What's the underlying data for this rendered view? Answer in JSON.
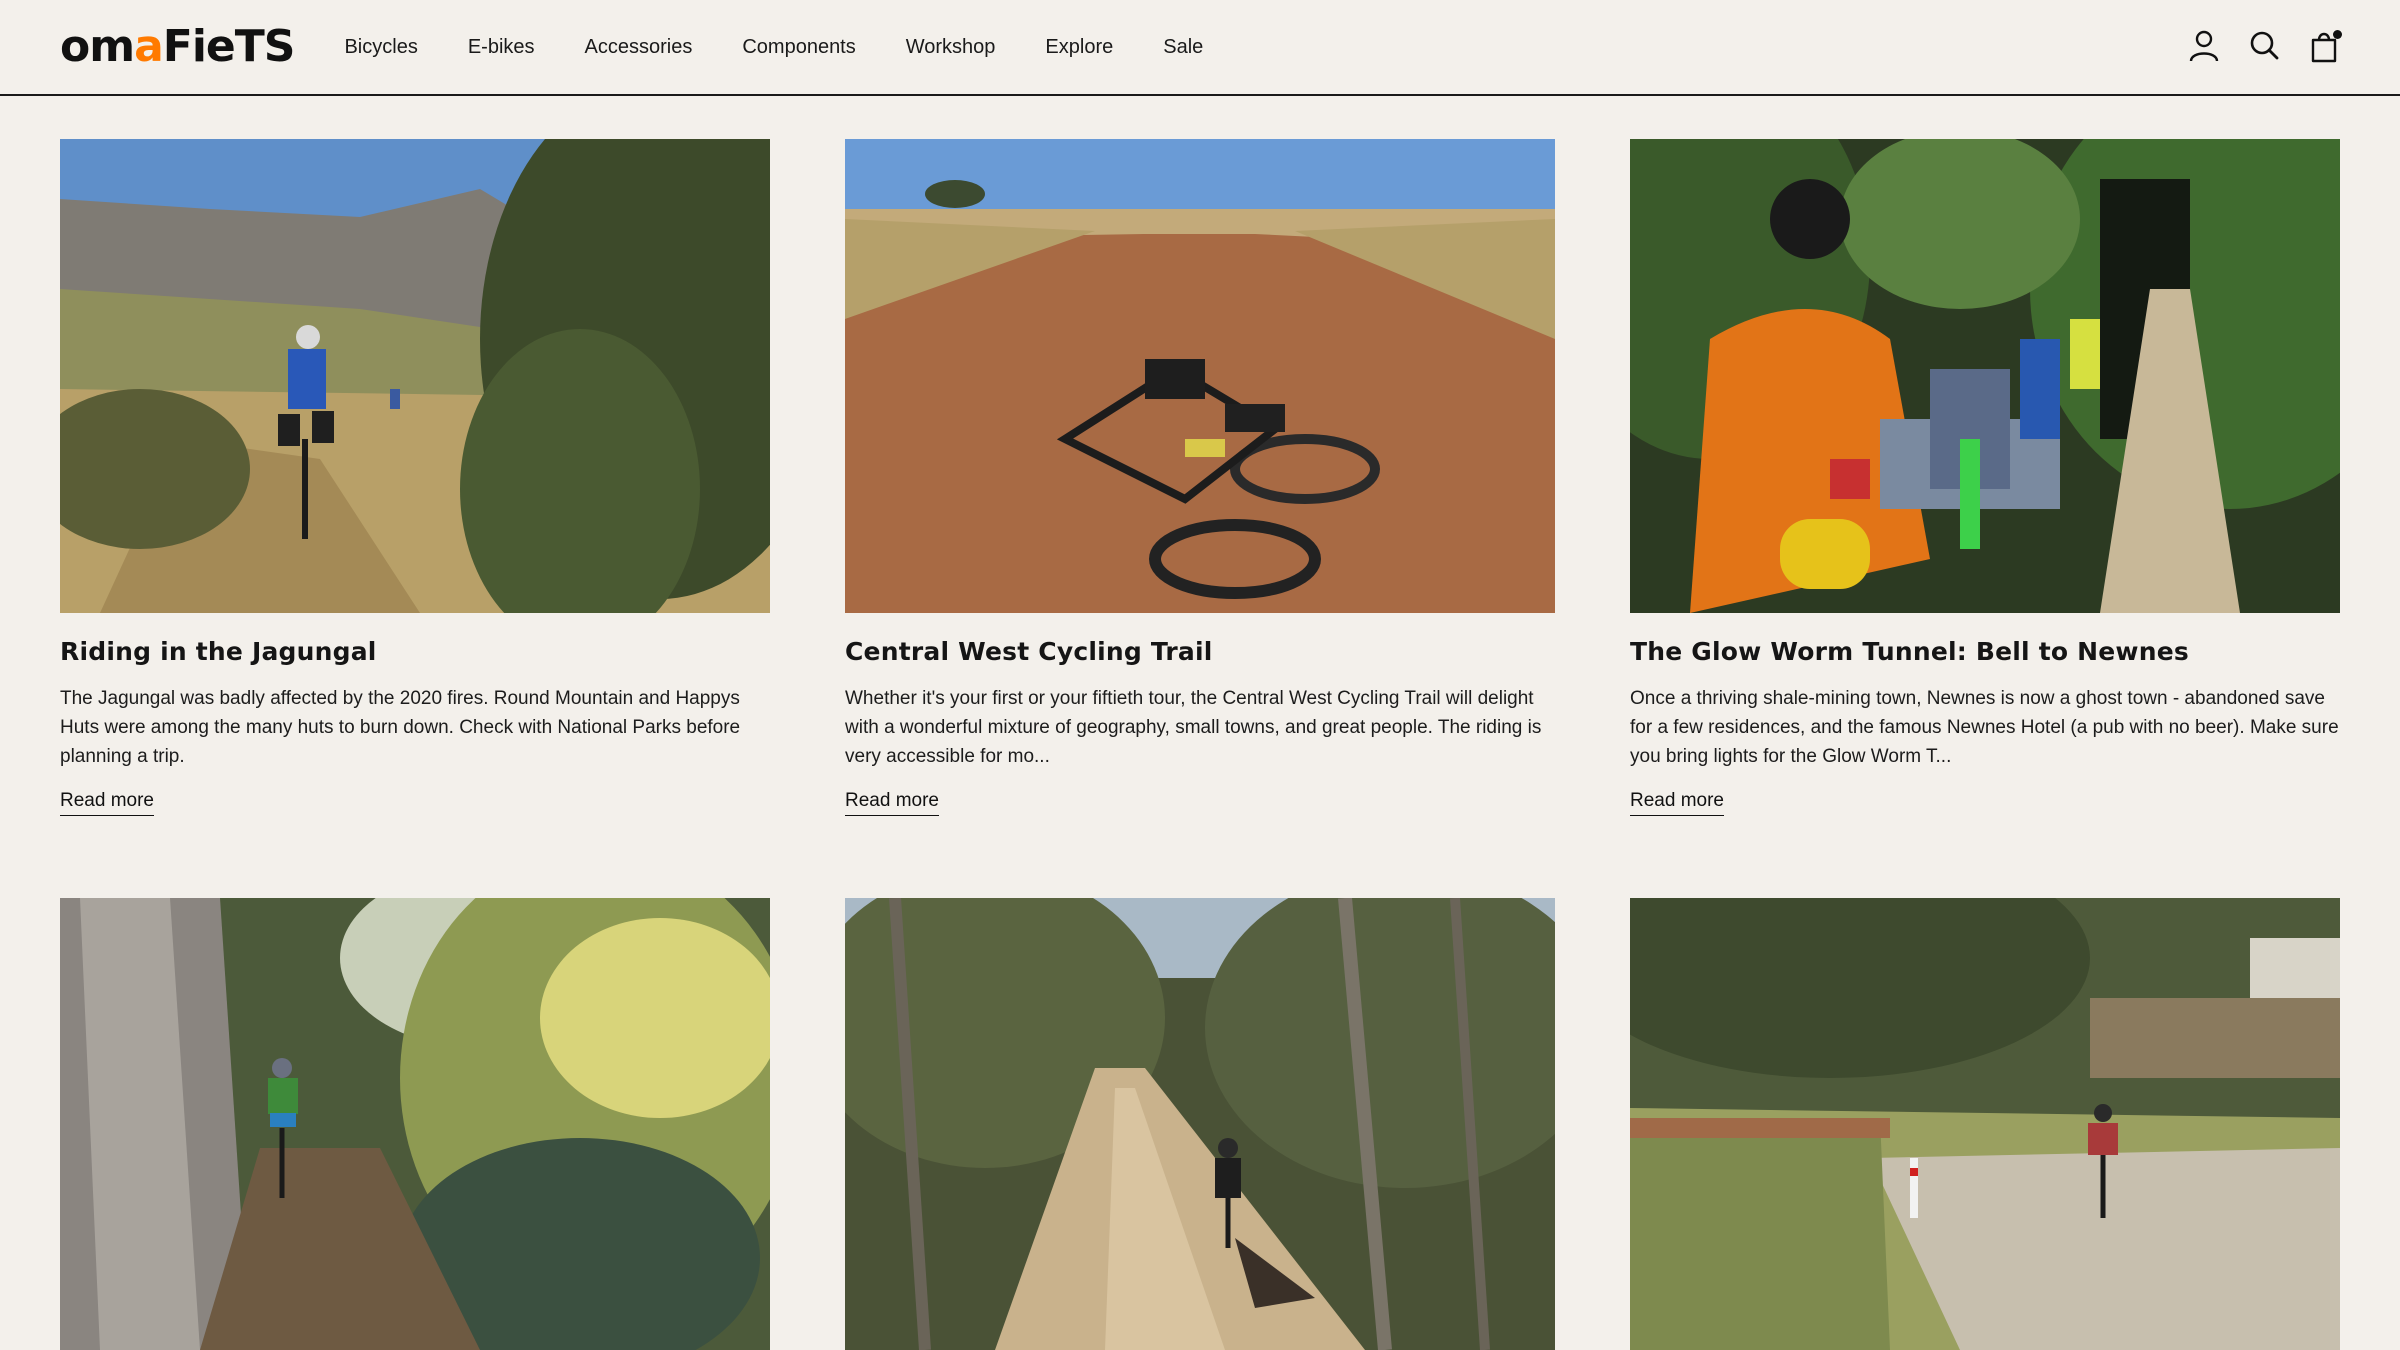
{
  "header": {
    "logo_part1": "om",
    "logo_accent": "a",
    "logo_part2": "FieTS",
    "nav": [
      "Bicycles",
      "E-bikes",
      "Accessories",
      "Components",
      "Workshop",
      "Explore",
      "Sale"
    ],
    "icons": [
      "account-icon",
      "search-icon",
      "cart-icon"
    ]
  },
  "articles": [
    {
      "title": "Riding in the Jagungal",
      "excerpt": "The Jagungal was badly affected by the 2020 fires. Round Mountain and Happys Huts were among the many huts to burn down. Check with National Parks before planning a trip.",
      "link": "Read more"
    },
    {
      "title": "Central West Cycling Trail",
      "excerpt": "Whether it's your first or your fiftieth tour, the Central West Cycling Trail will delight with a wonderful mixture of geography, small towns, and great people. The riding is very accessible for mo...",
      "link": "Read more"
    },
    {
      "title": "The Glow Worm Tunnel: Bell to Newnes",
      "excerpt": "Once a thriving shale-mining town, Newnes is now a ghost town - abandoned save for a few residences, and the famous Newnes Hotel (a pub with no beer). Make sure you bring lights for the Glow Worm T...",
      "link": "Read more"
    },
    {
      "title": "",
      "excerpt": "",
      "link": ""
    },
    {
      "title": "",
      "excerpt": "",
      "link": ""
    },
    {
      "title": "",
      "excerpt": "",
      "link": ""
    }
  ]
}
